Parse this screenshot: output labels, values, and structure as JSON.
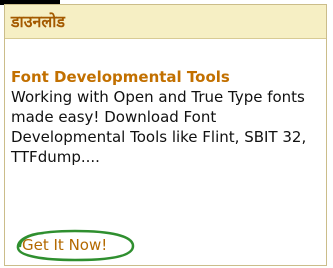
{
  "panel": {
    "title": "डाउनलोड",
    "accent_color": "#c27000",
    "header_bg": "#f6efc4",
    "border_color": "#cbbd8a"
  },
  "feature": {
    "title": "Font Developmental Tools",
    "description": "Working with Open and True Type fonts made easy! Download Font Developmental Tools like Flint, SBIT 32, TTFdump...."
  },
  "cta": {
    "label": "Get It Now!",
    "highlight_color": "#2f8f2f"
  }
}
